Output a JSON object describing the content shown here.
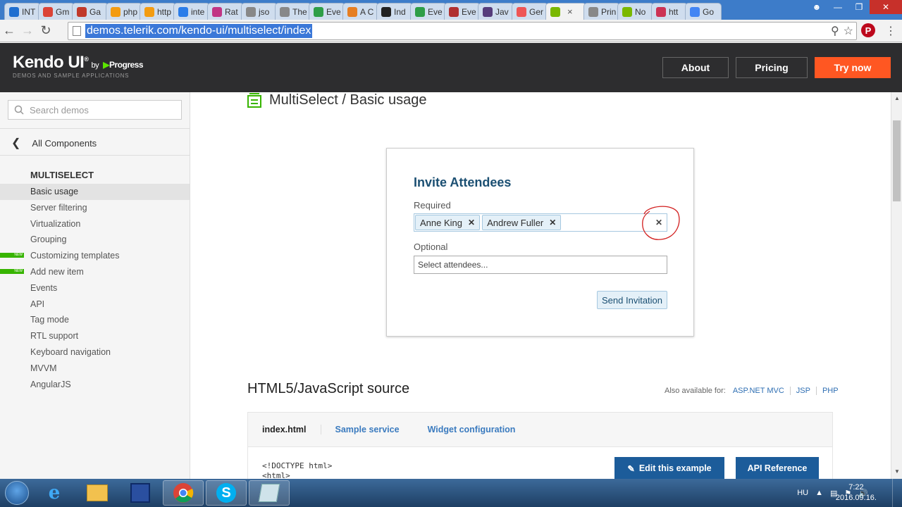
{
  "browser": {
    "tabs": [
      {
        "label": "INT",
        "color": "#1f6fd0"
      },
      {
        "label": "Gm",
        "color": "#db4437"
      },
      {
        "label": "Ga",
        "color": "#c0392b"
      },
      {
        "label": "php",
        "color": "#f39c12"
      },
      {
        "label": "http",
        "color": "#f39c12"
      },
      {
        "label": "inte",
        "color": "#2b7de9"
      },
      {
        "label": "Rat",
        "color": "#c13584"
      },
      {
        "label": "jso",
        "color": "#888888"
      },
      {
        "label": "The",
        "color": "#888888"
      },
      {
        "label": "Eve",
        "color": "#2e9e47"
      },
      {
        "label": "A C",
        "color": "#e67e22"
      },
      {
        "label": "Ind",
        "color": "#222222"
      },
      {
        "label": "Eve",
        "color": "#2e9e47"
      },
      {
        "label": "Eve",
        "color": "#b03030"
      },
      {
        "label": "Jav",
        "color": "#563d7c"
      },
      {
        "label": "Ger",
        "color": "#e55"
      },
      {
        "label": "",
        "color": "#7ab800",
        "active": true
      },
      {
        "label": "Prin",
        "color": "#888888"
      },
      {
        "label": "No",
        "color": "#7ab800"
      },
      {
        "label": "htt",
        "color": "#cc3355"
      },
      {
        "label": "Go",
        "color": "#4285f4"
      }
    ],
    "url": "demos.telerik.com/kendo-ui/multiselect/index"
  },
  "header": {
    "logo": "Kendo UI",
    "logo_by": "by",
    "logo_progress": "Progress",
    "logo_sub": "DEMOS AND SAMPLE APPLICATIONS",
    "about": "About",
    "pricing": "Pricing",
    "try_now": "Try now"
  },
  "sidebar": {
    "search_placeholder": "Search demos",
    "all_components": "All Components",
    "section": "MULTISELECT",
    "items": [
      {
        "label": "Basic usage",
        "active": true
      },
      {
        "label": "Server filtering"
      },
      {
        "label": "Virtualization"
      },
      {
        "label": "Grouping"
      },
      {
        "label": "Customizing templates",
        "badge": "NEW"
      },
      {
        "label": "Add new item",
        "badge": "NEW"
      },
      {
        "label": "Events"
      },
      {
        "label": "API"
      },
      {
        "label": "Tag mode"
      },
      {
        "label": "RTL support"
      },
      {
        "label": "Keyboard navigation"
      },
      {
        "label": "MVVM"
      },
      {
        "label": "AngularJS"
      }
    ]
  },
  "main": {
    "title": "MultiSelect / Basic usage",
    "demo": {
      "heading": "Invite Attendees",
      "required_label": "Required",
      "required_tags": [
        "Anne King",
        "Andrew Fuller"
      ],
      "optional_label": "Optional",
      "optional_placeholder": "Select attendees...",
      "send": "Send Invitation"
    },
    "source_title": "HTML5/JavaScript source",
    "also_available": "Also available for:",
    "platforms": [
      "ASP.NET MVC",
      "JSP",
      "PHP"
    ],
    "source_tabs": [
      "index.html",
      "Sample service",
      "Widget configuration"
    ],
    "code_lines": [
      "<!DOCTYPE html>",
      "<html>"
    ],
    "edit_example": "Edit this example",
    "api_reference": "API Reference"
  },
  "taskbar": {
    "lang": "HU",
    "time": "7:22",
    "date": "2016.09.16."
  }
}
